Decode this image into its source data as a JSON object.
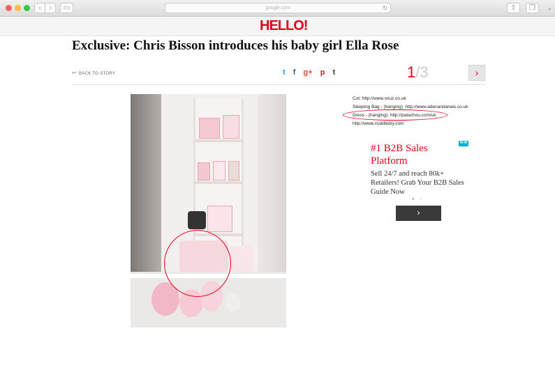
{
  "browser": {
    "address": "google.com",
    "reload_icon": "reload-icon",
    "colors": {
      "close": "#fc605c",
      "minimize": "#fdbc40",
      "zoom": "#34c84a"
    }
  },
  "site": {
    "logo": "HELLO!",
    "brand_color": "#e2001a"
  },
  "article": {
    "headline": "Exclusive: Chris Bisson introduces his baby girl Ella Rose",
    "back_label": "BACK TO STORY",
    "social": {
      "twitter": "t",
      "facebook": "f",
      "googleplus": "g+",
      "pinterest": "p",
      "tumblr": "t"
    },
    "pager": {
      "current": "1",
      "separator": "/",
      "total": "3"
    },
    "next_label": "›"
  },
  "credits": [
    "Cot:  http://www.snuz.co.uk",
    "Sleeping Bag - (hanging):  http://www.adenandanais.co.uk",
    "Dress - (hanging):  http://patachou.com/uk",
    "http://www.cuddledry.com"
  ],
  "ad": {
    "title": "#1 B2B Sales Platform",
    "body": "Sell 24/7 and reach 80k+ Retailers! Grab Your B2B Sales Guide Now",
    "cta": "›",
    "dots": "● ○"
  }
}
